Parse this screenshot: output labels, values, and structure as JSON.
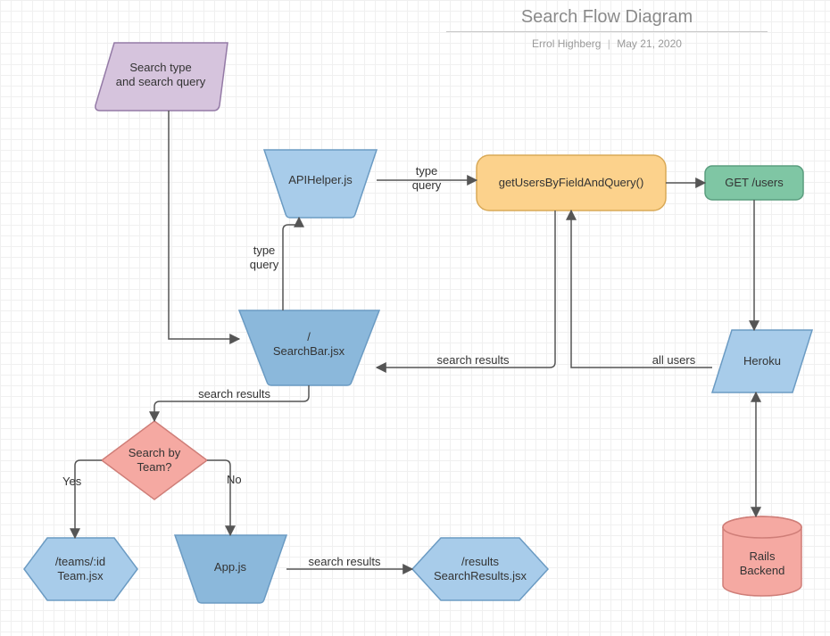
{
  "header": {
    "title": "Search Flow Diagram",
    "author": "Errol Highberg",
    "date": "May 21, 2020"
  },
  "nodes": {
    "start": {
      "line1": "Search type",
      "line2": "and search query"
    },
    "apiHelper": {
      "label": "APIHelper.js"
    },
    "getUsers": {
      "label": "getUsersByFieldAndQuery()"
    },
    "getEndpoint": {
      "label": "GET /users"
    },
    "searchBar": {
      "line1": "/",
      "line2": "SearchBar.jsx"
    },
    "heroku": {
      "label": "Heroku"
    },
    "decision": {
      "line1": "Search by",
      "line2": "Team?"
    },
    "team": {
      "line1": "/teams/:id",
      "line2": "Team.jsx"
    },
    "app": {
      "label": "App.js"
    },
    "results": {
      "line1": "/results",
      "line2": "SearchResults.jsx"
    },
    "rails": {
      "line1": "Rails",
      "line2": "Backend"
    }
  },
  "edges": {
    "typeQuery1": {
      "line1": "type",
      "line2": "query"
    },
    "typeQuery2": {
      "line1": "type",
      "line2": "query"
    },
    "searchResults1": "search results",
    "searchResults2": "search results",
    "searchResults3": "search results",
    "allUsers": "all users",
    "yes": "Yes",
    "no": "No"
  },
  "colors": {
    "purpleFill": "#d6c4dd",
    "purpleStroke": "#947aa6",
    "blueFill": "#a8ccea",
    "blueStroke": "#6b9bc3",
    "orangeFill": "#fcd28c",
    "orangeStroke": "#d9a956",
    "greenFill": "#7fc6a4",
    "greenStroke": "#5a9d7e",
    "redFill": "#f5a9a2",
    "redStroke": "#cf7e78",
    "blueDarkFill": "#8bb8db",
    "arrow": "#555"
  }
}
